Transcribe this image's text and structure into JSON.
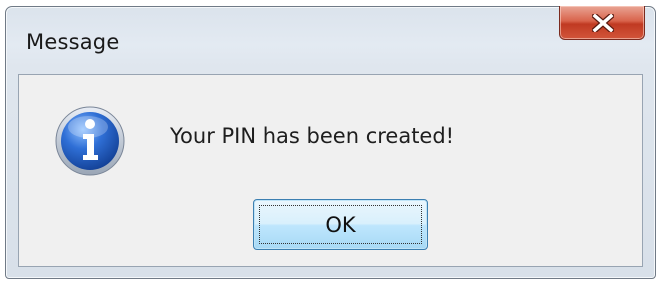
{
  "window": {
    "title": "Message"
  },
  "dialog": {
    "icon": "information-icon",
    "message": "Your PIN has been created!",
    "ok_label": "OK"
  },
  "titlebar": {
    "close_icon": "close-icon"
  },
  "colors": {
    "close_button": "#d2553a",
    "info_icon_blue": "#1f5bbf",
    "ok_button_border": "#3c7fb1"
  }
}
